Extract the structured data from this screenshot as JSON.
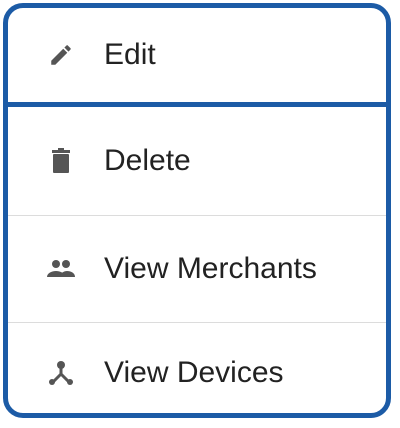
{
  "menu": {
    "items": [
      {
        "label": "Edit",
        "icon": "pencil-icon"
      },
      {
        "label": "Delete",
        "icon": "trash-icon"
      },
      {
        "label": "View Merchants",
        "icon": "people-icon"
      },
      {
        "label": "View Devices",
        "icon": "device-tree-icon"
      }
    ]
  },
  "colors": {
    "frame": "#1c5ba6",
    "text": "#222222",
    "icon": "#555555",
    "divider": "#dcdcdc"
  }
}
